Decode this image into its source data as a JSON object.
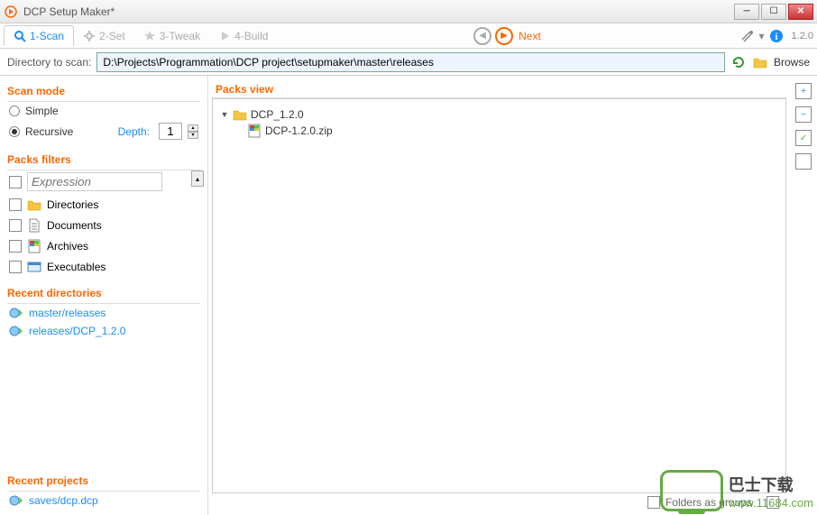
{
  "window": {
    "title": "DCP Setup Maker*"
  },
  "tabs": {
    "scan": "1-Scan",
    "set": "2-Set",
    "tweak": "3-Tweak",
    "build": "4-Build",
    "next": "Next"
  },
  "version": "1.2.0",
  "dirbar": {
    "label": "Directory to scan:",
    "value": "D:\\Projects\\Programmation\\DCP project\\setupmaker\\master\\releases",
    "browse": "Browse"
  },
  "scan_mode": {
    "title": "Scan mode",
    "simple": "Simple",
    "recursive": "Recursive",
    "depth_label": "Depth:",
    "depth_value": "1"
  },
  "filters": {
    "title": "Packs filters",
    "expression_placeholder": "Expression",
    "dirs": "Directories",
    "docs": "Documents",
    "arch": "Archives",
    "exec": "Executables"
  },
  "recent_dirs": {
    "title": "Recent directories",
    "items": [
      "master/releases",
      "releases/DCP_1.2.0"
    ]
  },
  "recent_projects": {
    "title": "Recent projects",
    "items": [
      "saves/dcp.dcp"
    ]
  },
  "packs_view": {
    "title": "Packs view",
    "folder": "DCP_1.2.0",
    "file": "DCP-1.2.0.zip",
    "bottom_text": "Folders as groups"
  },
  "watermark": {
    "cn": "巴士下载",
    "url": "www.11684.com"
  }
}
